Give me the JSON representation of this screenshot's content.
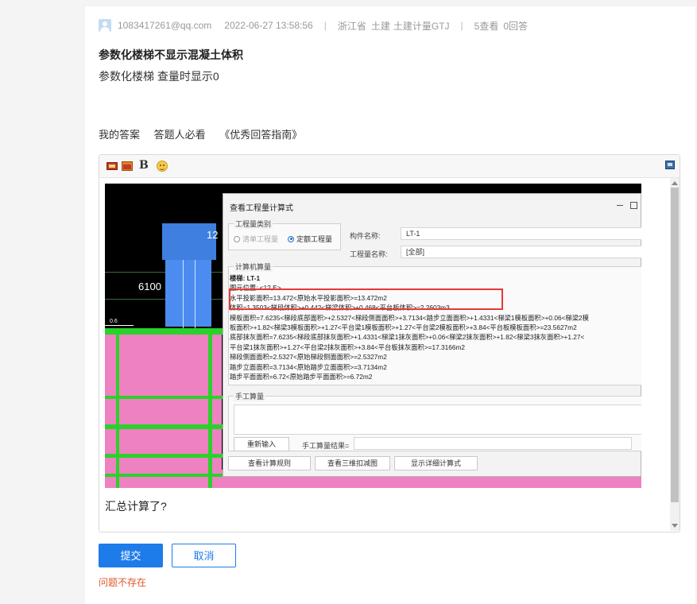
{
  "question": {
    "user": "1083417261@qq.com",
    "datetime": "2022-06-27 13:58:56",
    "separator": "|",
    "region": "浙江省",
    "category": "土建",
    "software": "土建计量GTJ",
    "views": "5查看",
    "answers": "0回答",
    "title": "参数化楼梯不显示混凝土体积",
    "body": "参数化楼梯 查量时显示0"
  },
  "answer_links": {
    "my_answer": "我的答案",
    "must_read": "答题人必看",
    "guide": "《优秀回答指南》"
  },
  "editor": {
    "toolbar": {
      "image_icon": "image-icon",
      "insert_image_icon": "insert-image-icon",
      "bold_label": "B",
      "emoji_icon": "emoji-icon",
      "fullscreen_icon": "fullscreen-icon"
    },
    "screenshot": {
      "cad_label_12": "12",
      "cad_label_6100": "6100",
      "cad_label_06": "0.6",
      "dialog": {
        "title": "查看工程量计算式",
        "quantity_type_label": "工程量类别",
        "radio_list": "清单工程量",
        "radio_quota": "定额工程量",
        "component_name_label": "构件名称:",
        "component_name_value": "LT-1",
        "quantity_name_label": "工程量名称:",
        "quantity_name_value": "[全部]",
        "computer_calc_label": "计算机算量",
        "calc_lines": [
          "楼梯: LT-1",
          "图元位置: <12,E>",
          "水平投影面积=13.472<原始水平投影面积>=13.472m2",
          "体积=1.3503<梯段体积>+0.442<梯梁体积>+0.468<平台板体积>=2.2603m3",
          "模板面积=7.6235<梯段底部面积>+2.5327<梯段侧面面积>+3.7134<踏步立面面积>+1.4331<梯梁1模板面积>+0.06<梯梁2模",
          "板面积>+1.82<梯梁3模板面积>+1.27<平台梁1模板面积>+1.27<平台梁2模板面积>+3.84<平台板模板面积>=23.5627m2",
          "底部抹灰面积=7.6235<梯段底部抹灰面积>+1.4331<梯梁1抹灰面积>+0.06<梯梁2抹灰面积>+1.82<梯梁3抹灰面积>+1.27<",
          "平台梁1抹灰面积>+1.27<平台梁2抹灰面积>+3.84<平台板抹灰面积>=17.3166m2",
          "梯段侧面面积=2.5327<原始梯段侧面面积>=2.5327m2",
          "踏步立面面积=3.7134<原始踏步立面面积>=3.7134m2",
          "踏步平面面积=6.72<原始踏步平面面积>=6.72m2"
        ],
        "manual_calc_label": "手工算量",
        "reinput_button": "重新输入",
        "manual_result_label": "手工算量结果=",
        "view_rules_button": "查看计算规则",
        "view_3d_button": "查看三维扣减图",
        "show_detail_button": "显示详细计算式"
      }
    },
    "summary_text": "汇总计算了?"
  },
  "actions": {
    "submit": "提交",
    "cancel": "取消"
  },
  "error_text": "问题不存在",
  "colors": {
    "primary": "#1e7bea",
    "error": "#e0582a",
    "highlight_box": "#e53935"
  }
}
